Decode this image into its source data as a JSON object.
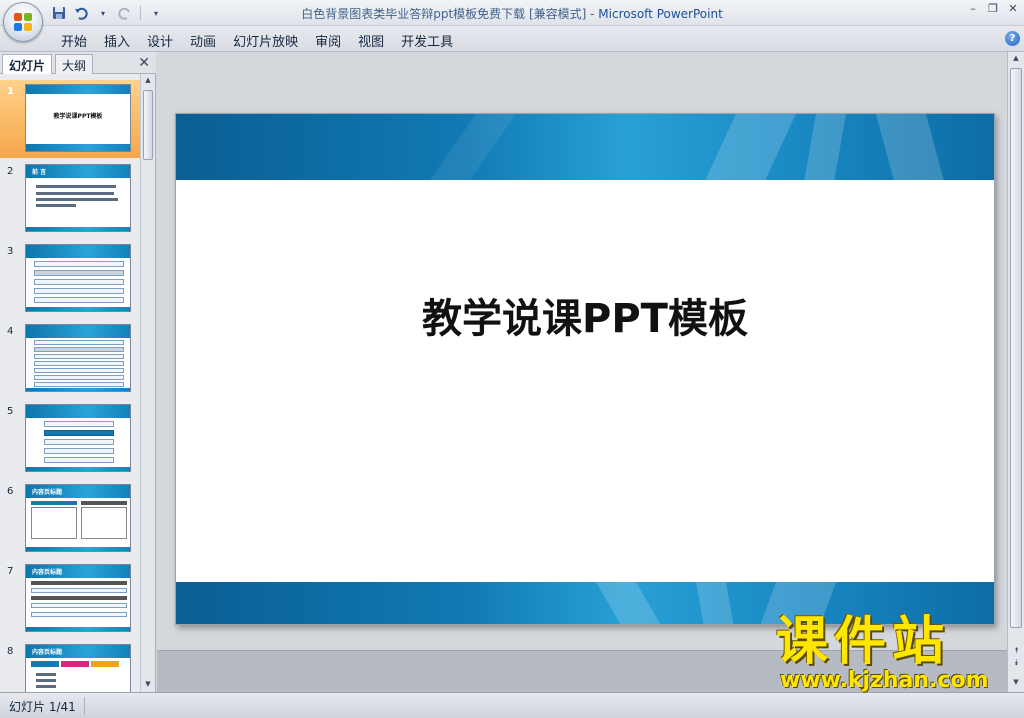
{
  "window": {
    "title_doc": "白色背景图表类毕业答辩ppt模板免费下载 [兼容模式] - ",
    "title_app": "Microsoft PowerPoint"
  },
  "qat": {
    "save_icon": "save-icon",
    "undo_icon": "undo-icon",
    "redo_icon": "redo-icon"
  },
  "menu": {
    "items": [
      "开始",
      "插入",
      "设计",
      "动画",
      "幻灯片放映",
      "审阅",
      "视图",
      "开发工具"
    ]
  },
  "left_pane": {
    "tabs": [
      "幻灯片",
      "大纲"
    ],
    "close": "✕",
    "thumbnails": [
      {
        "num": "1",
        "title": "教学说课PPT模板"
      },
      {
        "num": "2",
        "title": "前 言"
      },
      {
        "num": "3",
        "title": ""
      },
      {
        "num": "4",
        "title": ""
      },
      {
        "num": "5",
        "title": ""
      },
      {
        "num": "6",
        "title": "内容页标题"
      },
      {
        "num": "7",
        "title": "内容页标题"
      },
      {
        "num": "8",
        "title": "内容页标题"
      }
    ]
  },
  "slide": {
    "title": "教学说课PPT模板"
  },
  "status": {
    "slide_info": "幻灯片 1/41"
  },
  "watermark": {
    "title": "课件站",
    "url": "www.kjzhan.com"
  },
  "colors": {
    "accent_band": "#1179b4",
    "selected_thumb": "#f5a64a",
    "watermark": "#ffe600"
  }
}
